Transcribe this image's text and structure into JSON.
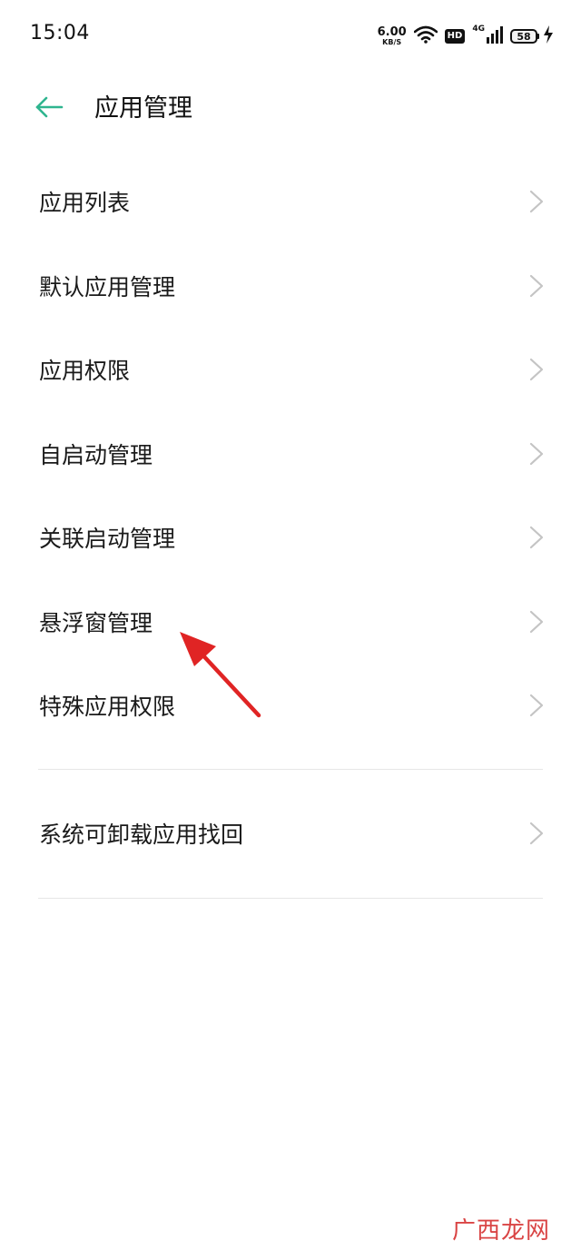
{
  "status_bar": {
    "time": "15:04",
    "net_speed_value": "6.00",
    "net_speed_unit": "KB/S",
    "hd_label": "HD",
    "net_type": "4G",
    "battery_level": "58"
  },
  "header": {
    "title": "应用管理"
  },
  "menu": {
    "items": [
      {
        "label": "应用列表"
      },
      {
        "label": "默认应用管理"
      },
      {
        "label": "应用权限"
      },
      {
        "label": "自启动管理"
      },
      {
        "label": "关联启动管理"
      },
      {
        "label": "悬浮窗管理"
      },
      {
        "label": "特殊应用权限"
      }
    ],
    "secondary_items": [
      {
        "label": "系统可卸载应用找回"
      }
    ]
  },
  "watermark": "广西龙网",
  "colors": {
    "accent": "#2fb58f",
    "annotation_arrow": "#e02424",
    "divider": "#e6e6e6"
  }
}
